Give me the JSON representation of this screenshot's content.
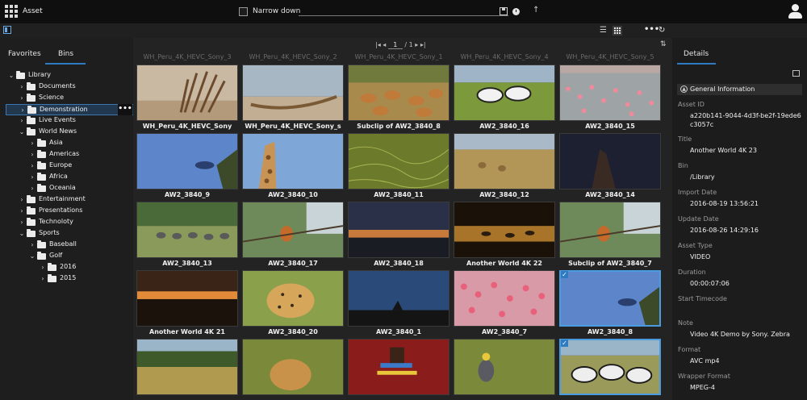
{
  "app": {
    "title": "Asset"
  },
  "search": {
    "narrow_label": "Narrow down"
  },
  "left_tabs": {
    "favorites": "Favorites",
    "bins": "Bins"
  },
  "tree": [
    {
      "label": "Library",
      "depth": 0,
      "expanded": true
    },
    {
      "label": "Documents",
      "depth": 1
    },
    {
      "label": "Science",
      "depth": 1
    },
    {
      "label": "Demonstration",
      "depth": 1,
      "selected": true
    },
    {
      "label": "Live Events",
      "depth": 1
    },
    {
      "label": "World News",
      "depth": 1,
      "expanded": true
    },
    {
      "label": "Asia",
      "depth": 2
    },
    {
      "label": "Americas",
      "depth": 2
    },
    {
      "label": "Europe",
      "depth": 2
    },
    {
      "label": "Africa",
      "depth": 2
    },
    {
      "label": "Oceania",
      "depth": 2
    },
    {
      "label": "Entertainment",
      "depth": 1
    },
    {
      "label": "Presentations",
      "depth": 1
    },
    {
      "label": "Technoloty",
      "depth": 1
    },
    {
      "label": "Sports",
      "depth": 1,
      "expanded": true
    },
    {
      "label": "Baseball",
      "depth": 2
    },
    {
      "label": "Golf",
      "depth": 2,
      "expanded": true
    },
    {
      "label": "2016",
      "depth": 3
    },
    {
      "label": "2015",
      "depth": 3
    }
  ],
  "pager": {
    "current": "1",
    "total": "1"
  },
  "column_titles": [
    "WH_Peru_4K_HEVC_Sony_3",
    "WH_Peru_4K_HEVC_Sony_2",
    "WH_Peru_4K_HEVC_Sony_1",
    "WH_Peru_4K_HEVC_Sony_4",
    "WH_Peru_4K_HEVC_Sony_5"
  ],
  "assets": [
    {
      "caption": "WH_Peru_4K_HEVC_Sony",
      "scene": "desert-sculpture"
    },
    {
      "caption": "WH_Peru_4K_HEVC_Sony_s",
      "scene": "beach-boat"
    },
    {
      "caption": "Subclip of AW2_3840_8",
      "scene": "impala-herd"
    },
    {
      "caption": "AW2_3840_16",
      "scene": "zebras-grass"
    },
    {
      "caption": "AW2_3840_15",
      "scene": "flamingos-water"
    },
    {
      "caption": "AW2_3840_9",
      "scene": "bird-sky"
    },
    {
      "caption": "AW2_3840_10",
      "scene": "giraffe-sky"
    },
    {
      "caption": "AW2_3840_11",
      "scene": "green-texture"
    },
    {
      "caption": "AW2_3840_12",
      "scene": "savanna-lions"
    },
    {
      "caption": "AW2_3840_14",
      "scene": "night-termite"
    },
    {
      "caption": "AW2_3840_13",
      "scene": "elephants-field"
    },
    {
      "caption": "AW2_3840_17",
      "scene": "bird-branch"
    },
    {
      "caption": "AW2_3840_18",
      "scene": "sunset-clouds"
    },
    {
      "caption": "Another World 4K 22",
      "scene": "hippos-water"
    },
    {
      "caption": "Subclip of AW2_3840_7",
      "scene": "bird-branch"
    },
    {
      "caption": "Another World 4K 21",
      "scene": "sunset-animal"
    },
    {
      "caption": "AW2_3840_20",
      "scene": "cheetah"
    },
    {
      "caption": "AW2_3840_1",
      "scene": "dusk-tree"
    },
    {
      "caption": "AW2_3840_7",
      "scene": "flamingos-pink"
    },
    {
      "caption": "AW2_3840_8",
      "scene": "bird-sky",
      "selected": true
    },
    {
      "caption": "",
      "scene": "savanna-tree"
    },
    {
      "caption": "",
      "scene": "lioness"
    },
    {
      "caption": "",
      "scene": "masai-beads"
    },
    {
      "caption": "",
      "scene": "crane-bird"
    },
    {
      "caption": "",
      "scene": "zebras-herd",
      "selected": true
    }
  ],
  "details": {
    "tab": "Details",
    "section": "General Information",
    "fields": [
      {
        "label": "Asset ID",
        "value": "a220b141-9044-4d3f-be2f-19ede6c3057c"
      },
      {
        "label": "Title",
        "value": "Another World 4K 23"
      },
      {
        "label": "Bin",
        "value": "/Library"
      },
      {
        "label": "Import Date",
        "value": "2016-08-19 13:56:21"
      },
      {
        "label": "Update Date",
        "value": "2016-08-26 14:29:16"
      },
      {
        "label": "Asset Type",
        "value": "VIDEO"
      },
      {
        "label": "Duration",
        "value": "00:00:07:06"
      },
      {
        "label": "Start Timecode",
        "value": ""
      },
      {
        "label": "Note",
        "value": "Video 4K Demo by Sony. Zebra"
      },
      {
        "label": "Format",
        "value": "AVC mp4"
      },
      {
        "label": "Wrapper Format",
        "value": "MPEG-4"
      }
    ]
  },
  "colors": {
    "accent": "#2f7bc1",
    "selection": "#4b9be0",
    "background": "#1a1a1a"
  }
}
